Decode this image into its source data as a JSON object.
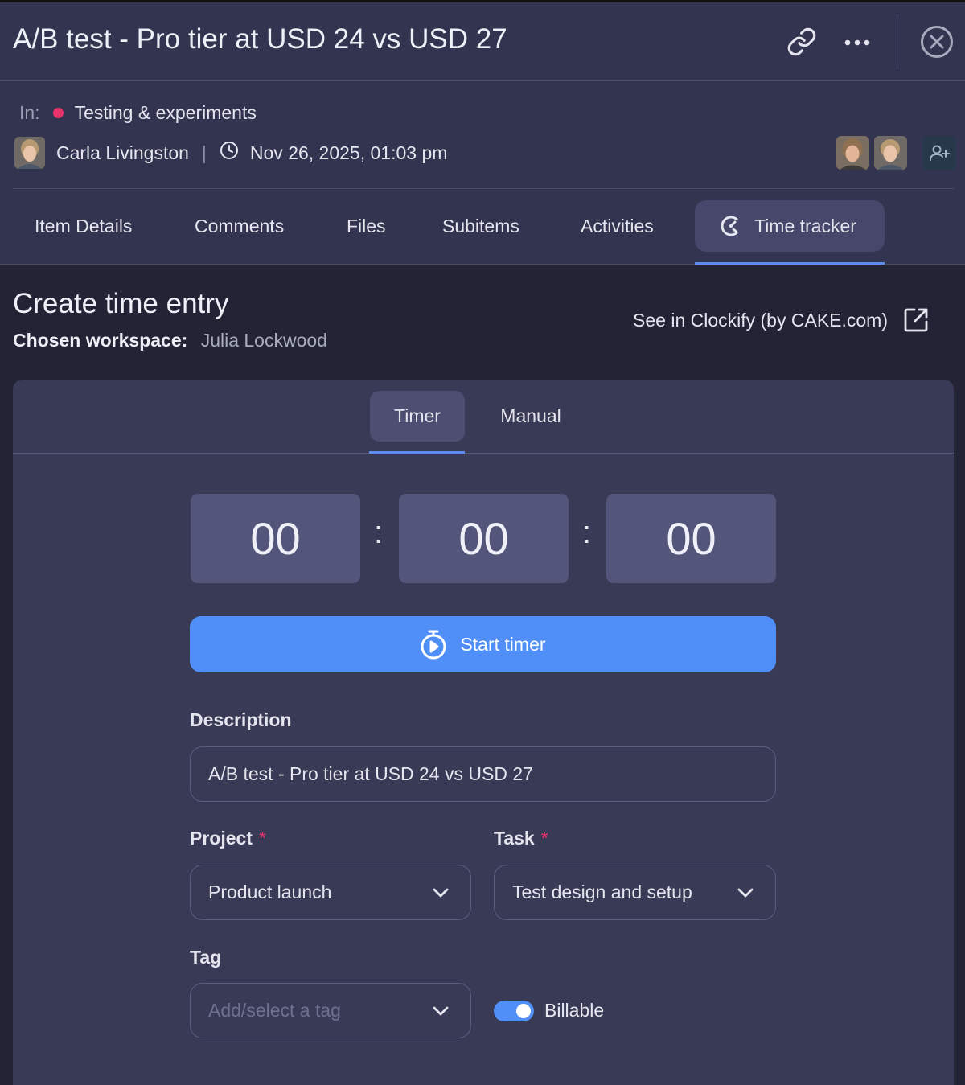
{
  "header": {
    "title": "A/B test - Pro tier at USD 24 vs USD 27",
    "icons": [
      "link-icon",
      "more-icon",
      "close-icon"
    ]
  },
  "meta": {
    "in_label": "In:",
    "group": "Testing & experiments",
    "group_color": "#e8336b",
    "author": "Carla Livingston",
    "separator": "|",
    "created": "Nov 26, 2025, 01:03 pm"
  },
  "tabs": [
    "Item Details",
    "Comments",
    "Files",
    "Subitems",
    "Activities",
    "Time tracker"
  ],
  "active_tab": "Time tracker",
  "entry": {
    "title": "Create time entry",
    "workspace_label": "Chosen workspace:",
    "workspace_value": "Julia Lockwood",
    "see_link": "See in Clockify (by CAKE.com)"
  },
  "mode_tabs": [
    "Timer",
    "Manual"
  ],
  "active_mode": "Timer",
  "timer": {
    "hours": "00",
    "minutes": "00",
    "seconds": "00",
    "separator": ":"
  },
  "start_button": "Start timer",
  "form": {
    "description_label": "Description",
    "description_value": "A/B test - Pro tier at USD 24 vs USD 27",
    "project_label": "Project",
    "project_value": "Product launch",
    "task_label": "Task",
    "task_value": "Test design and setup",
    "required_mark": "*",
    "tag_label": "Tag",
    "tag_placeholder": "Add/select a tag",
    "billable_label": "Billable",
    "billable_on": true
  },
  "colors": {
    "accent": "#4f8ff7",
    "panel": "#33344f",
    "card": "#393a55",
    "required": "#e8336b"
  }
}
